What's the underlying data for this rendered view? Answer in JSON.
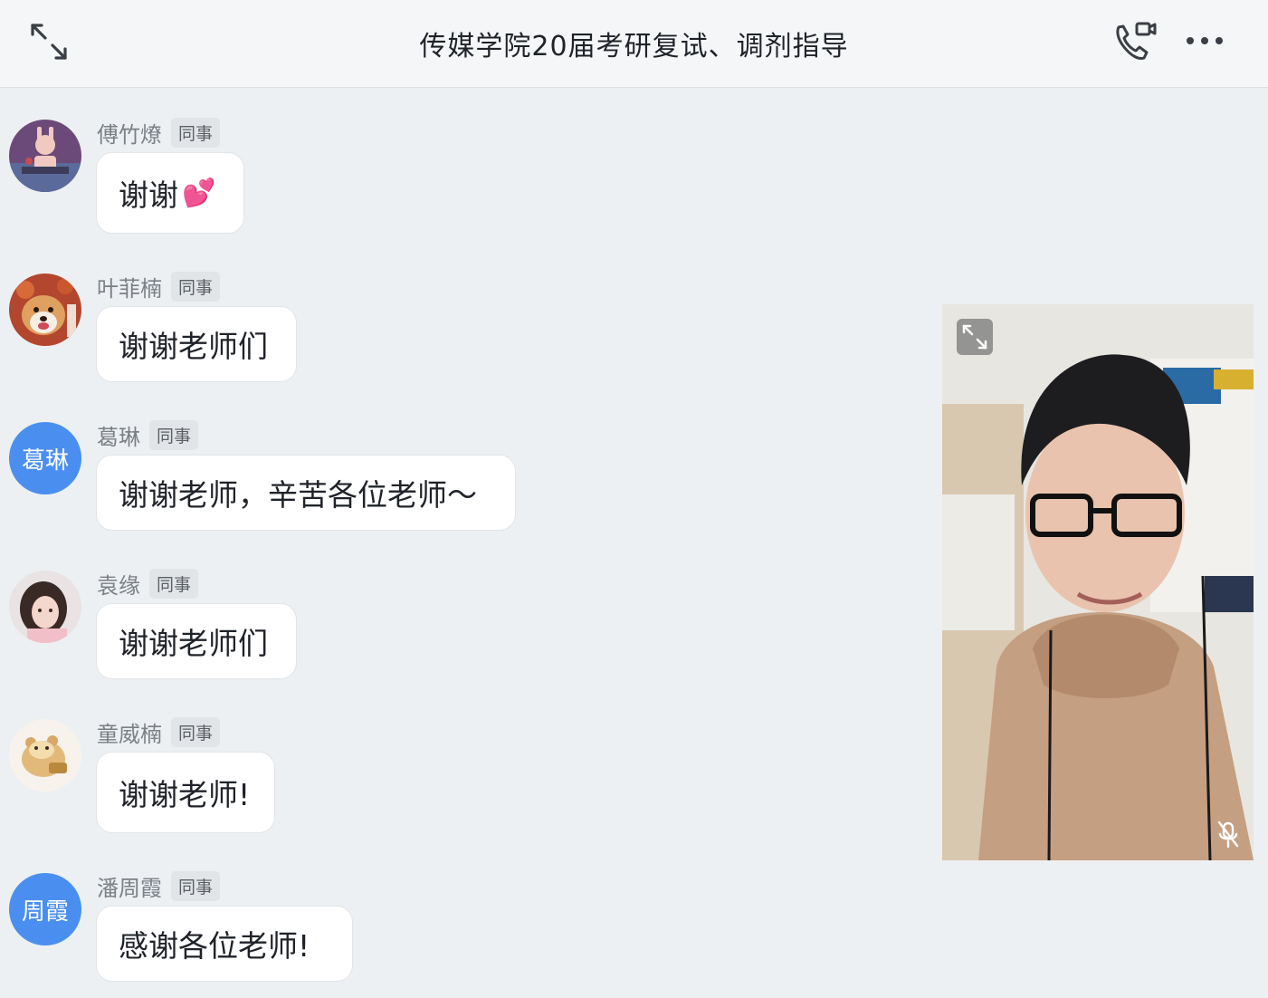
{
  "header": {
    "title": "传媒学院20届考研复试、调剂指导",
    "expand_icon": "expand-arrows-icon",
    "call_icon": "phone-video-call-icon",
    "more_icon": "more-dots-icon"
  },
  "messages": [
    {
      "sender": "傅竹燎",
      "tag": "同事",
      "text": "谢谢",
      "emoji": "💕",
      "avatar": "illustration-avatar"
    },
    {
      "sender": "叶菲楠",
      "tag": "同事",
      "text": "谢谢老师们",
      "avatar": "dog-avatar"
    },
    {
      "sender": "葛琳",
      "tag": "同事",
      "text": "谢谢老师，辛苦各位老师～",
      "avatar_text": "葛琳"
    },
    {
      "sender": "袁缘",
      "tag": "同事",
      "text": "谢谢老师们",
      "avatar": "girl-photo-avatar"
    },
    {
      "sender": "童威楠",
      "tag": "同事",
      "text": "谢谢老师!",
      "avatar": "hamster-avatar"
    },
    {
      "sender": "潘周霞",
      "tag": "同事",
      "text": "感谢各位老师!",
      "avatar_text": "周霞"
    }
  ],
  "video": {
    "expand_icon": "expand-arrows-icon",
    "mic_icon": "mic-muted-icon"
  },
  "colors": {
    "background": "#edf0f2",
    "header": "#f5f6f7",
    "avatar_blue": "#4a8ff0",
    "bubble": "#ffffff"
  }
}
